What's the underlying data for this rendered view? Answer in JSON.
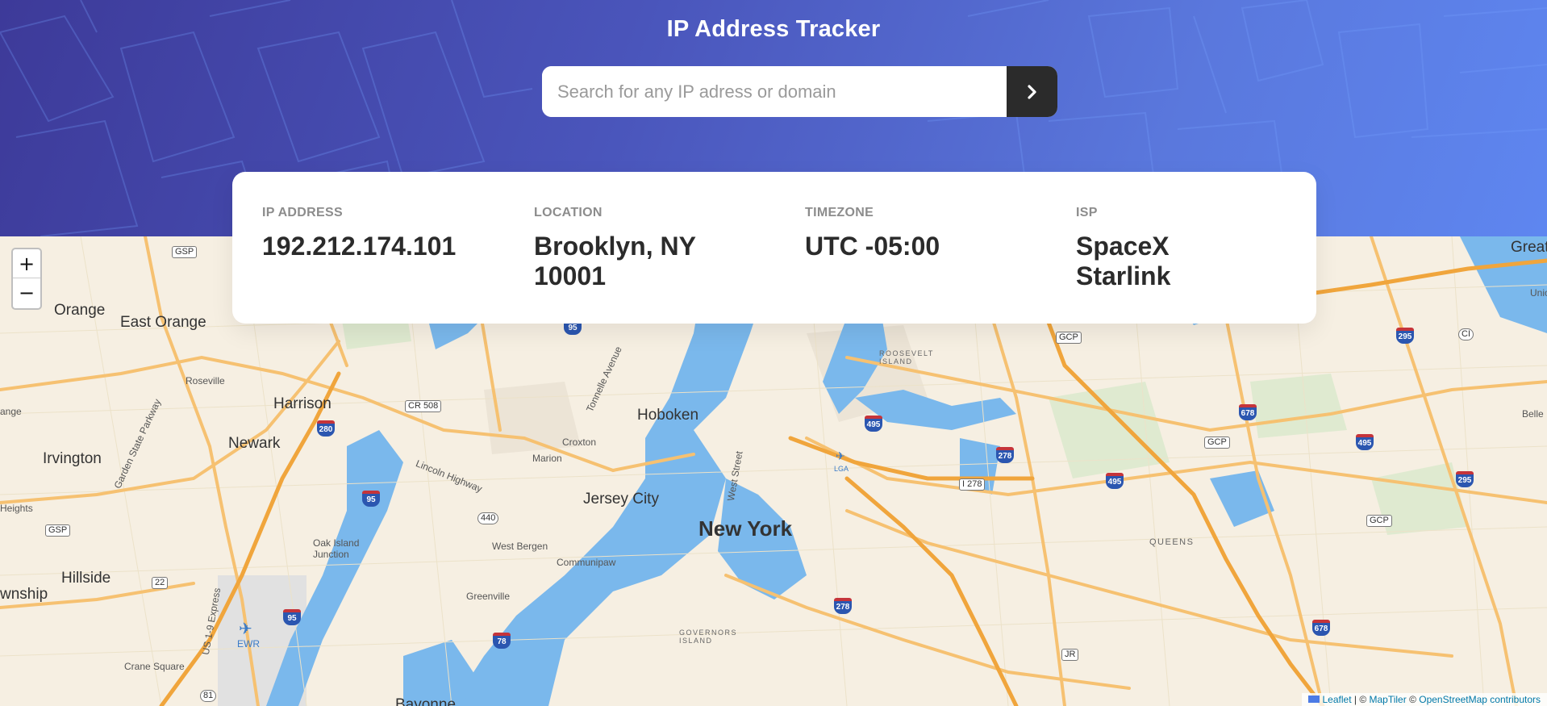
{
  "header": {
    "title": "IP Address Tracker",
    "search_placeholder": "Search for any IP adress or domain",
    "search_value": ""
  },
  "info": {
    "ip_label": "IP ADDRESS",
    "ip_value": "192.212.174.101",
    "location_label": "LOCATION",
    "location_value": "Brooklyn, NY 10001",
    "timezone_label": "TIMEZONE",
    "timezone_value": "UTC -05:00",
    "isp_label": "ISP",
    "isp_value": "SpaceX Starlink"
  },
  "map": {
    "zoom_in": "+",
    "zoom_out": "−",
    "attribution_leaflet": "Leaflet",
    "attribution_sep": " | © ",
    "attribution_maptiler": "MapTiler",
    "attribution_sep2": " © ",
    "attribution_osm": "OpenStreetMap contributors",
    "labels": {
      "new_york": "New York",
      "newark": "Newark",
      "jersey_city": "Jersey City",
      "hoboken": "Hoboken",
      "harrison": "Harrison",
      "irvington": "Irvington",
      "orange": "Orange",
      "east_orange": "East Orange",
      "hillside": "Hillside",
      "queens": "QUEENS",
      "roosevelt_island": "ROOSEVELT\nISLAND",
      "governors_island": "GOVERNORS\nISLAND",
      "ewr": "EWR",
      "lga": "LGA",
      "bayonne": "Bayonne",
      "township": "wnship",
      "great": "Great",
      "west_bergen": "West Bergen",
      "communipaw": "Communipaw",
      "greenville": "Greenville",
      "marion": "Marion",
      "croxton": "Croxton",
      "roseville": "Roseville",
      "oak_island_junction": "Oak Island\nJunction",
      "crane_square": "Crane Square",
      "lincoln_highway": "Lincoln Highway",
      "garden_state_parkway": "Garden State Parkway",
      "tonnelle_avenue": "Tonnelle Avenue",
      "west_street": "West Street",
      "us_1_9_express": "US 1-9 Express",
      "heights": "Heights",
      "belle": "Belle",
      "unio": "Unio",
      "ange": "ange"
    },
    "shields": {
      "gsp": "GSP",
      "gcp": "GCP",
      "cr508": "CR 508",
      "i278": "I 278",
      "jr": "JR",
      "ci": "CI",
      "r440": "440",
      "r22": "22",
      "r81": "81"
    },
    "interstates": [
      "280",
      "95",
      "78",
      "278",
      "495",
      "678",
      "295",
      "95",
      "278",
      "495",
      "495",
      "678",
      "295",
      "295",
      "95"
    ]
  },
  "colors": {
    "header_start": "#3d3a99",
    "header_end": "#5e86f0",
    "water": "#7ab8ec",
    "land": "#f6efe2",
    "road": "#f6c171",
    "highway": "#f2a93b"
  }
}
